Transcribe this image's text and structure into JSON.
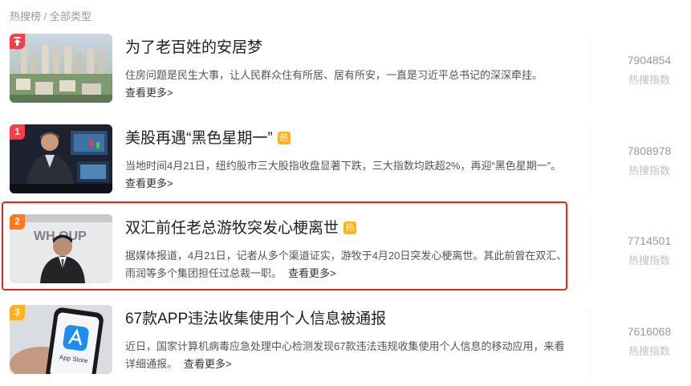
{
  "breadcrumb": "热搜榜 / 全部类型",
  "items": [
    {
      "rank": "",
      "title": "为了老百姓的安居梦",
      "hot_badge": "",
      "desc": "住房问题是民生大事，让人民群众住有所居、居有所安，一直是习近平总书记的深深牵挂。",
      "more": "查看更多>",
      "score": "7904854",
      "score_label": "热搜指数"
    },
    {
      "rank": "1",
      "title": "美股再遇“黑色星期一”",
      "hot_badge": "热",
      "desc": "当地时间4月21日，纽约股市三大股指收盘显著下跌，三大指数均跌超2%，再迎“黑色星期一”。",
      "more": "查看更多>",
      "score": "7808978",
      "score_label": "热搜指数"
    },
    {
      "rank": "2",
      "title": "双汇前任老总游牧突发心梗离世",
      "hot_badge": "热",
      "desc": "据媒体报道，4月21日，记者从多个渠道证实，游牧于4月20日突发心梗离世。其此前曾在双汇、雨润等多个集团担任过总裁一职。",
      "more": "查看更多>",
      "score": "7714501",
      "score_label": "热搜指数"
    },
    {
      "rank": "3",
      "title": "67款APP违法收集使用个人信息被通报",
      "hot_badge": "",
      "desc": "近日，国家计算机病毒应急处理中心检测发现67款违法违规收集使用个人信息的移动应用，来看详细通报。",
      "more": "查看更多>",
      "score": "7616068",
      "score_label": "热搜指数"
    }
  ],
  "thumb_texts": {
    "wh_logo": "WH OUP",
    "app_store": "App Store"
  },
  "colors": {
    "rank_red": "#f1404b",
    "rank_orange": "#ff7a1f",
    "rank_gold": "#ffb11b",
    "highlight_border": "#e5261f"
  }
}
